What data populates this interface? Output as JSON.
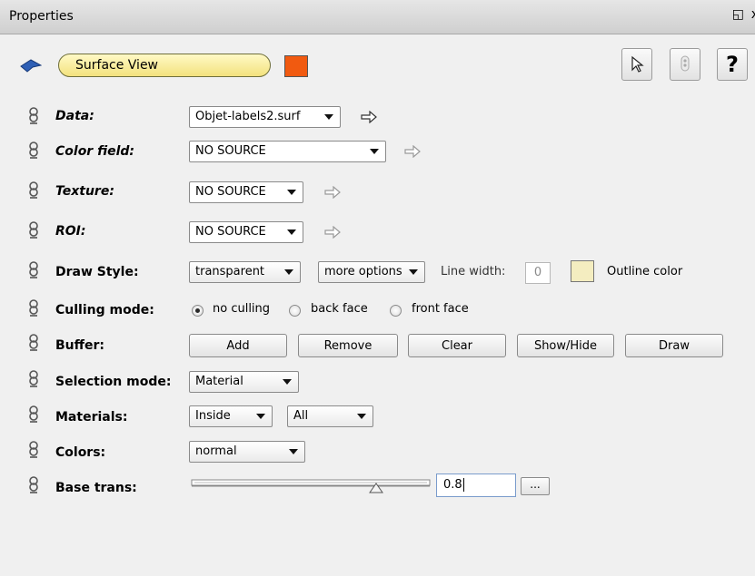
{
  "window": {
    "title": "Properties",
    "float_glyph": "◱",
    "close_glyph": "x"
  },
  "module": {
    "name": "Surface View",
    "color": "#f15a10"
  },
  "toolbar": {
    "help_label": "?"
  },
  "rows": {
    "data": {
      "label": "Data:",
      "value": "Objet-labels2.surf"
    },
    "color_field": {
      "label": "Color field:",
      "value": "NO SOURCE"
    },
    "texture": {
      "label": "Texture:",
      "value": "NO SOURCE"
    },
    "roi": {
      "label": "ROI:",
      "value": "NO SOURCE"
    },
    "draw_style": {
      "label": "Draw Style:",
      "value": "transparent",
      "more_options": "more options",
      "line_width_label": "Line width:",
      "line_width_value": "0",
      "outline_color_label": "Outline color",
      "outline_color": "#f4edc0"
    },
    "culling_mode": {
      "label": "Culling mode:",
      "options": [
        "no culling",
        "back face",
        "front face"
      ],
      "selected": "no culling"
    },
    "buffer": {
      "label": "Buffer:",
      "buttons": [
        "Add",
        "Remove",
        "Clear",
        "Show/Hide",
        "Draw"
      ]
    },
    "selection_mode": {
      "label": "Selection mode:",
      "value": "Material"
    },
    "materials": {
      "label": "Materials:",
      "value1": "Inside",
      "value2": "All"
    },
    "colors": {
      "label": "Colors:",
      "value": "normal"
    },
    "base_trans": {
      "label": "Base trans:",
      "value": "0.8",
      "slider_value": 0.8,
      "more_button": "..."
    }
  }
}
